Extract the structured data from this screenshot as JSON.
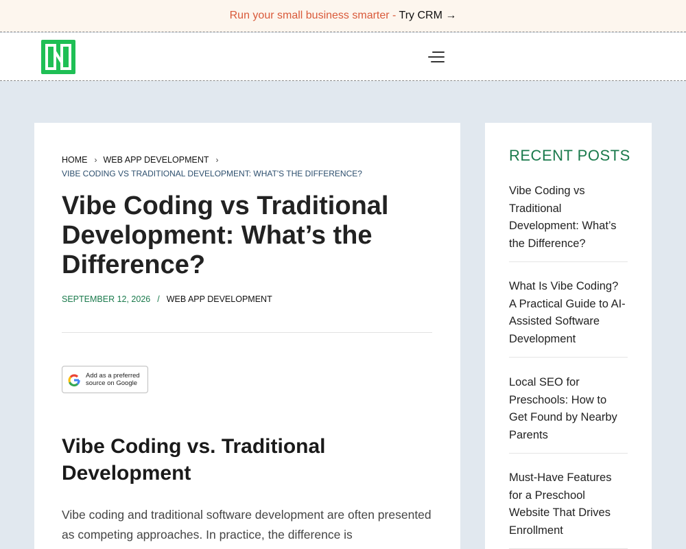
{
  "promo": {
    "text": "Run your small business smarter - ",
    "link": "Try CRM →"
  },
  "header": {
    "logo": "site-logo"
  },
  "breadcrumb": {
    "home": "HOME",
    "category": "WEB APP DEVELOPMENT",
    "current": "VIBE CODING VS TRADITIONAL DEVELOPMENT: WHAT'S THE DIFFERENCE?"
  },
  "article": {
    "title": "Vibe Coding vs Traditional Development: What’s the Difference?",
    "date": "SEPTEMBER 12, 2026",
    "separator": "/",
    "category": "WEB APP DEVELOPMENT",
    "google_badge": {
      "line1": "Add as a preferred",
      "line2": "source on Google"
    },
    "h2": "Vibe Coding vs. Traditional Development",
    "intro": "Vibe coding and traditional software development are often presented as competing approaches. In practice, the difference is"
  },
  "sidebar": {
    "title": "RECENT POSTS",
    "posts": [
      "Vibe Coding vs Traditional Development: What’s the Difference?",
      "What Is Vibe Coding? A Practical Guide to AI-Assisted Software Development",
      "Local SEO for Preschools: How to Get Found by Nearby Parents",
      "Must-Have Features for a Preschool Website That Drives Enrollment"
    ]
  },
  "colors": {
    "brand": "#1fbf55",
    "accent": "#1a7a4c",
    "promo": "#d95a3a"
  }
}
